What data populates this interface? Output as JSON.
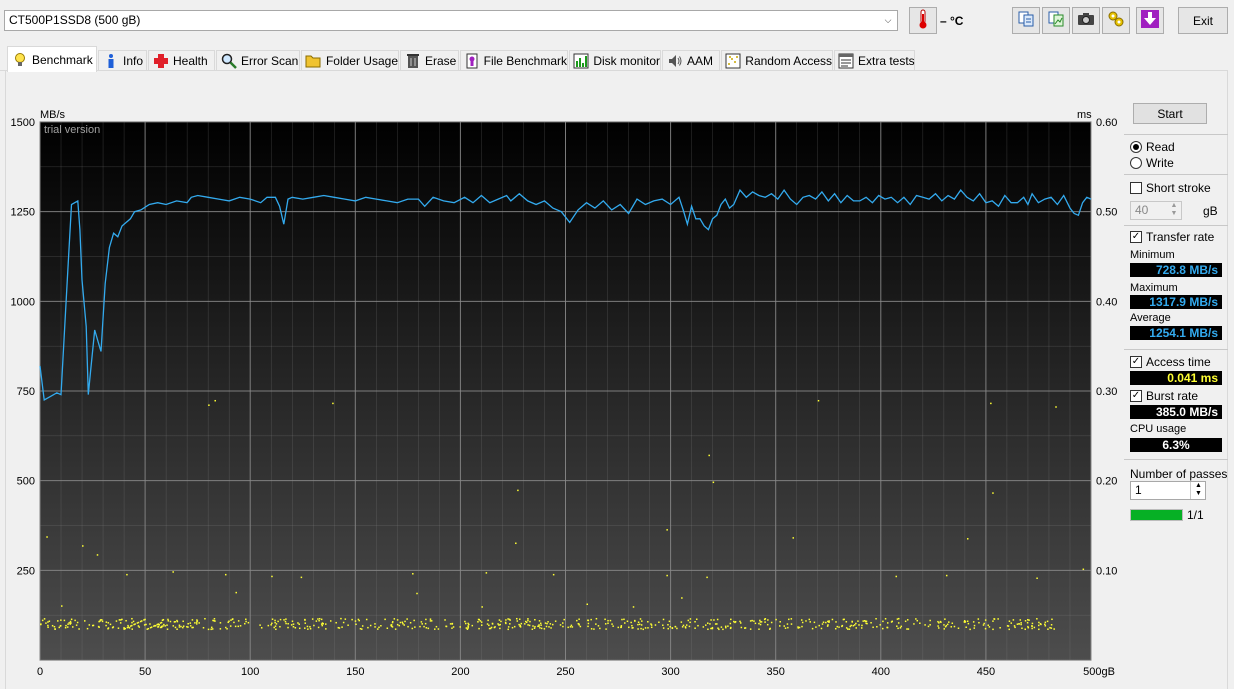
{
  "drive": {
    "selected": "CT500P1SSD8 (500 gB)"
  },
  "toolbar": {
    "temperature": "– °C",
    "exit_label": "Exit",
    "icons": [
      "thermometer-icon",
      "copy-text-icon",
      "copy-image-icon",
      "camera-icon",
      "options-icon",
      "save-down-icon"
    ]
  },
  "tabs": [
    {
      "label": "Benchmark",
      "icon": "lightbulb-icon",
      "active": true
    },
    {
      "label": "Info",
      "icon": "info-icon"
    },
    {
      "label": "Health",
      "icon": "health-cross-icon"
    },
    {
      "label": "Error Scan",
      "icon": "magnifier-icon"
    },
    {
      "label": "Folder Usage",
      "icon": "folder-icon"
    },
    {
      "label": "Erase",
      "icon": "trash-icon"
    },
    {
      "label": "File Benchmark",
      "icon": "file-benchmark-icon"
    },
    {
      "label": "Disk monitor",
      "icon": "disk-monitor-icon"
    },
    {
      "label": "AAM",
      "icon": "speaker-icon"
    },
    {
      "label": "Random Access",
      "icon": "random-access-icon"
    },
    {
      "label": "Extra tests",
      "icon": "extra-tests-icon"
    }
  ],
  "chart_data": {
    "type": "line",
    "watermark": "trial version",
    "left_axis_unit": "MB/s",
    "right_axis_unit": "ms",
    "x_unit": "gB",
    "xlim": [
      0,
      500
    ],
    "ylim_left": [
      0,
      1500
    ],
    "ylim_right": [
      0,
      0.6
    ],
    "x_ticks": [
      0,
      50,
      100,
      150,
      200,
      250,
      300,
      350,
      400,
      450,
      500
    ],
    "y_left_ticks": [
      250,
      500,
      750,
      1000,
      1250,
      1500
    ],
    "y_right_ticks": [
      "0.10",
      "0.20",
      "0.30",
      "0.40",
      "0.50",
      "0.60"
    ],
    "grid": true,
    "colors": {
      "background_top": "#000000",
      "background_bottom": "#4d4d4d",
      "grid": "#888888",
      "transfer": "#33aaee",
      "access": "#ffff33"
    },
    "series": [
      {
        "kind": "transfer_rate",
        "points": [
          [
            0,
            820
          ],
          [
            2,
            725
          ],
          [
            5,
            735
          ],
          [
            8,
            745
          ],
          [
            10,
            740
          ],
          [
            13,
            1060
          ],
          [
            15,
            1270
          ],
          [
            18,
            1280
          ],
          [
            19,
            1200
          ],
          [
            20,
            1060
          ],
          [
            22,
            930
          ],
          [
            23,
            740
          ],
          [
            24,
            800
          ],
          [
            26,
            920
          ],
          [
            28,
            880
          ],
          [
            29,
            860
          ],
          [
            31,
            1050
          ],
          [
            33,
            1150
          ],
          [
            35,
            1190
          ],
          [
            37,
            1180
          ],
          [
            39,
            1210
          ],
          [
            41,
            1220
          ],
          [
            43,
            1230
          ],
          [
            45,
            1250
          ],
          [
            48,
            1255
          ],
          [
            52,
            1270
          ],
          [
            56,
            1275
          ],
          [
            60,
            1270
          ],
          [
            65,
            1280
          ],
          [
            70,
            1275
          ],
          [
            72,
            1290
          ],
          [
            75,
            1295
          ],
          [
            80,
            1290
          ],
          [
            85,
            1285
          ],
          [
            90,
            1280
          ],
          [
            95,
            1290
          ],
          [
            100,
            1285
          ],
          [
            105,
            1275
          ],
          [
            108,
            1290
          ],
          [
            112,
            1290
          ],
          [
            114,
            1265
          ],
          [
            116,
            1215
          ],
          [
            118,
            1285
          ],
          [
            120,
            1290
          ],
          [
            125,
            1285
          ],
          [
            130,
            1290
          ],
          [
            135,
            1295
          ],
          [
            140,
            1290
          ],
          [
            145,
            1285
          ],
          [
            150,
            1280
          ],
          [
            155,
            1290
          ],
          [
            160,
            1285
          ],
          [
            165,
            1280
          ],
          [
            170,
            1275
          ],
          [
            175,
            1285
          ],
          [
            180,
            1285
          ],
          [
            183,
            1265
          ],
          [
            187,
            1290
          ],
          [
            192,
            1280
          ],
          [
            197,
            1275
          ],
          [
            202,
            1290
          ],
          [
            206,
            1275
          ],
          [
            210,
            1295
          ],
          [
            214,
            1275
          ],
          [
            218,
            1285
          ],
          [
            222,
            1295
          ],
          [
            224,
            1280
          ],
          [
            228,
            1300
          ],
          [
            232,
            1280
          ],
          [
            236,
            1270
          ],
          [
            240,
            1280
          ],
          [
            244,
            1260
          ],
          [
            248,
            1250
          ],
          [
            252,
            1220
          ],
          [
            256,
            1255
          ],
          [
            260,
            1275
          ],
          [
            264,
            1260
          ],
          [
            268,
            1280
          ],
          [
            272,
            1255
          ],
          [
            276,
            1270
          ],
          [
            280,
            1245
          ],
          [
            284,
            1285
          ],
          [
            288,
            1270
          ],
          [
            292,
            1280
          ],
          [
            296,
            1285
          ],
          [
            300,
            1270
          ],
          [
            304,
            1290
          ],
          [
            306,
            1255
          ],
          [
            308,
            1215
          ],
          [
            310,
            1265
          ],
          [
            312,
            1230
          ],
          [
            314,
            1230
          ],
          [
            316,
            1210
          ],
          [
            318,
            1200
          ],
          [
            320,
            1230
          ],
          [
            322,
            1240
          ],
          [
            324,
            1270
          ],
          [
            326,
            1285
          ],
          [
            328,
            1260
          ],
          [
            330,
            1270
          ],
          [
            333,
            1310
          ],
          [
            336,
            1290
          ],
          [
            339,
            1305
          ],
          [
            342,
            1295
          ],
          [
            345,
            1290
          ],
          [
            348,
            1300
          ],
          [
            351,
            1285
          ],
          [
            354,
            1310
          ],
          [
            357,
            1285
          ],
          [
            360,
            1270
          ],
          [
            363,
            1290
          ],
          [
            366,
            1295
          ],
          [
            369,
            1285
          ],
          [
            372,
            1305
          ],
          [
            375,
            1280
          ],
          [
            378,
            1300
          ],
          [
            381,
            1275
          ],
          [
            384,
            1295
          ],
          [
            387,
            1280
          ],
          [
            390,
            1280
          ],
          [
            393,
            1290
          ],
          [
            396,
            1275
          ],
          [
            399,
            1295
          ],
          [
            402,
            1285
          ],
          [
            405,
            1290
          ],
          [
            408,
            1275
          ],
          [
            411,
            1290
          ],
          [
            414,
            1270
          ],
          [
            417,
            1295
          ],
          [
            420,
            1290
          ],
          [
            423,
            1285
          ],
          [
            426,
            1300
          ],
          [
            429,
            1280
          ],
          [
            432,
            1295
          ],
          [
            435,
            1285
          ],
          [
            438,
            1310
          ],
          [
            441,
            1290
          ],
          [
            444,
            1280
          ],
          [
            447,
            1300
          ],
          [
            450,
            1275
          ],
          [
            453,
            1280
          ],
          [
            456,
            1265
          ],
          [
            459,
            1295
          ],
          [
            462,
            1275
          ],
          [
            465,
            1275
          ],
          [
            468,
            1290
          ],
          [
            470,
            1270
          ],
          [
            472,
            1300
          ],
          [
            475,
            1275
          ],
          [
            478,
            1285
          ],
          [
            481,
            1290
          ],
          [
            484,
            1270
          ],
          [
            487,
            1295
          ],
          [
            490,
            1260
          ],
          [
            492,
            1245
          ],
          [
            494,
            1240
          ],
          [
            496,
            1275
          ],
          [
            498,
            1290
          ],
          [
            500,
            1285
          ]
        ]
      },
      {
        "kind": "access_time",
        "cluster_ms": [
          0.035,
          0.047
        ],
        "outliers": [
          [
            80,
            0.285
          ],
          [
            83,
            0.29
          ],
          [
            139,
            0.287
          ],
          [
            3,
            0.138
          ],
          [
            20,
            0.128
          ],
          [
            27,
            0.118
          ],
          [
            41,
            0.096
          ],
          [
            63,
            0.099
          ],
          [
            88,
            0.096
          ],
          [
            110,
            0.094
          ],
          [
            124,
            0.093
          ],
          [
            177,
            0.097
          ],
          [
            212,
            0.098
          ],
          [
            244,
            0.096
          ],
          [
            298,
            0.095
          ],
          [
            317,
            0.093
          ],
          [
            318,
            0.229
          ],
          [
            320,
            0.199
          ],
          [
            226,
            0.131
          ],
          [
            227,
            0.19
          ],
          [
            282,
            0.06
          ],
          [
            298,
            0.146
          ],
          [
            370,
            0.29
          ],
          [
            431,
            0.095
          ],
          [
            452,
            0.287
          ],
          [
            453,
            0.187
          ],
          [
            474,
            0.092
          ],
          [
            483,
            0.283
          ],
          [
            496,
            0.102
          ],
          [
            358,
            0.137
          ],
          [
            407,
            0.094
          ],
          [
            441,
            0.136
          ],
          [
            210,
            0.06
          ],
          [
            305,
            0.07
          ],
          [
            260,
            0.063
          ],
          [
            93,
            0.076
          ],
          [
            179,
            0.075
          ],
          [
            10,
            0.061
          ]
        ]
      }
    ]
  },
  "panel": {
    "start_label": "Start",
    "read_label": "Read",
    "write_label": "Write",
    "short_stroke_label": "Short stroke",
    "short_stroke_value": "40",
    "short_stroke_unit": "gB",
    "transfer_rate_label": "Transfer rate",
    "minimum_label": "Minimum",
    "minimum_value": "728.8 MB/s",
    "maximum_label": "Maximum",
    "maximum_value": "1317.9 MB/s",
    "average_label": "Average",
    "average_value": "1254.1 MB/s",
    "access_time_label": "Access time",
    "access_time_value": "0.041 ms",
    "burst_rate_label": "Burst rate",
    "burst_rate_value": "385.0 MB/s",
    "cpu_usage_label": "CPU usage",
    "cpu_usage_value": "6.3%",
    "passes_label": "Number of passes",
    "passes_value": "1",
    "pass_progress_text": "1/1",
    "pass_progress": 1.0,
    "colors": {
      "transfer_values": "#33aaee",
      "access_value": "#ffff33",
      "other_values": "#ffffff"
    }
  }
}
